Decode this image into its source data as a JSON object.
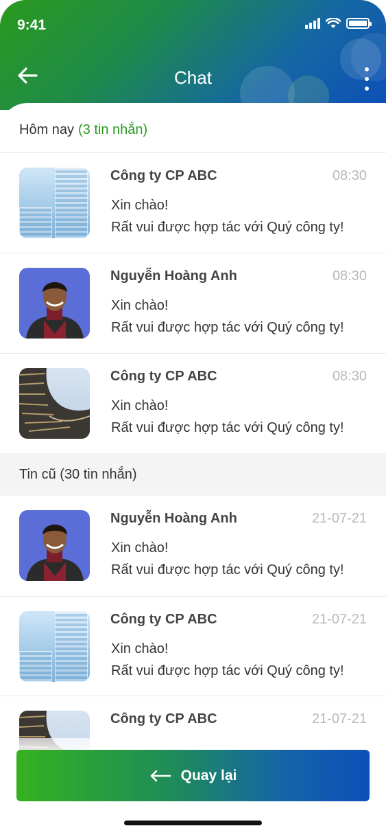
{
  "status": {
    "time": "9:41"
  },
  "header": {
    "title": "Chat"
  },
  "today": {
    "label": "Hôm nay",
    "count": "(3 tin nhắn)"
  },
  "older": {
    "label": "Tin cũ (30 tin nhắn)"
  },
  "today_messages": [
    {
      "sender": "Công ty CP ABC",
      "time": "08:30",
      "line1": "Xin chào!",
      "line2": "Rất vui được hợp tác với Quý công ty!",
      "avatar": "building-photo"
    },
    {
      "sender": "Nguyễn Hoàng Anh",
      "time": "08:30",
      "line1": "Xin chào!",
      "line2": "Rất vui được hợp tác với Quý công ty!",
      "avatar": "person-photo"
    },
    {
      "sender": "Công ty CP ABC",
      "time": "08:30",
      "line1": "Xin chào!",
      "line2": "Rất vui được hợp tác với Quý công ty!",
      "avatar": "architecture-photo"
    }
  ],
  "older_messages": [
    {
      "sender": "Nguyễn Hoàng Anh",
      "time": "21-07-21",
      "line1": "Xin chào!",
      "line2": "Rất vui được hợp tác với Quý công ty!",
      "avatar": "person-photo"
    },
    {
      "sender": "Công ty CP ABC",
      "time": "21-07-21",
      "line1": "Xin chào!",
      "line2": "Rất vui được hợp tác với Quý công ty!",
      "avatar": "building-photo"
    },
    {
      "sender": "Công ty CP ABC",
      "time": "21-07-21",
      "line1": "",
      "line2": "",
      "avatar": "architecture-photo"
    }
  ],
  "footer": {
    "button_label": "Quay lại"
  },
  "colors": {
    "brand_green": "#2a9a1e",
    "brand_blue": "#0c4fb8",
    "timestamp": "#b8b8b8"
  }
}
